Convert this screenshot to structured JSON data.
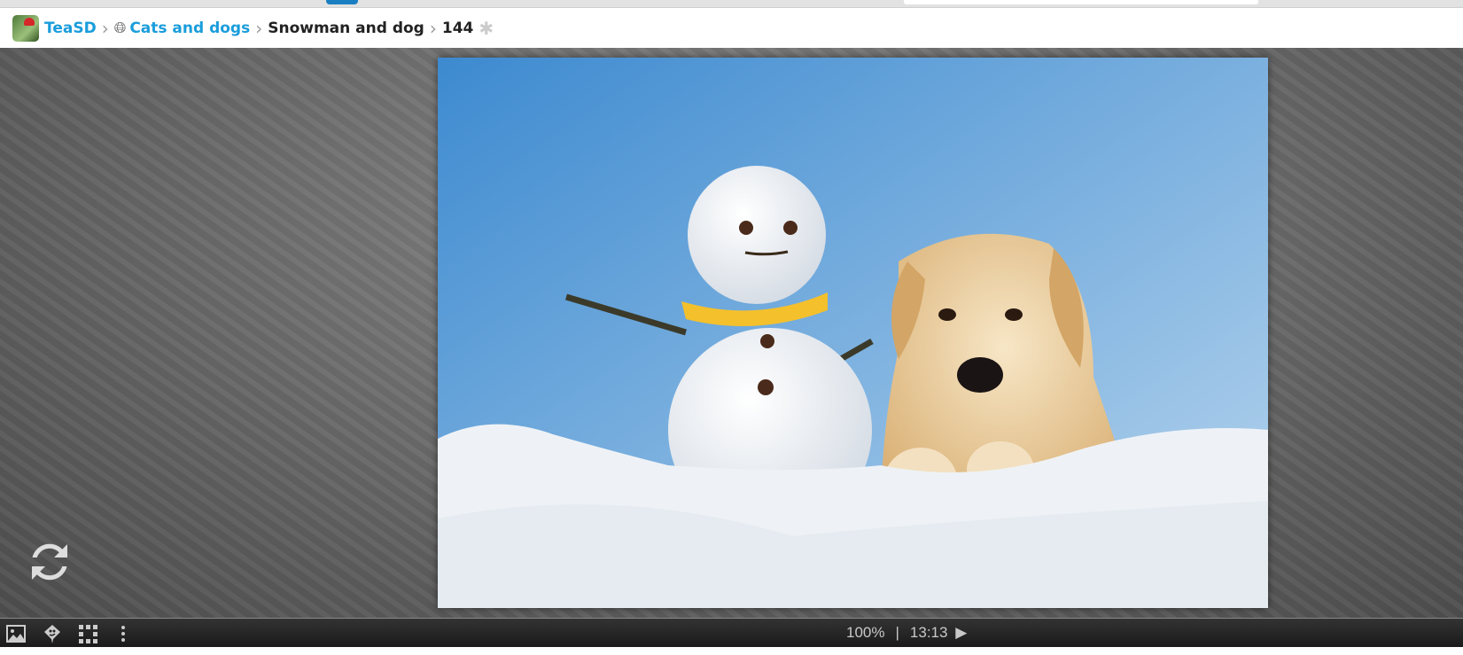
{
  "breadcrumb": {
    "site": "TeaSD",
    "category": "Cats and dogs",
    "album": "Snowman and dog",
    "item": "144"
  },
  "icons": [
    "app-logo",
    "chevron-right-icon",
    "globe-icon",
    "puzzle-icon",
    "refresh-icon",
    "image-icon",
    "map-pin-icon",
    "grid-icon",
    "more-vertical-icon",
    "play-icon"
  ],
  "photo": {
    "subject": "Snowman and dog"
  },
  "statusbar": {
    "zoom": "100%",
    "separator": "|",
    "time": "13:13"
  },
  "colors": {
    "link": "#1a9ddb",
    "bar": "#1f1f1f",
    "stage": "#6e6e6e"
  }
}
